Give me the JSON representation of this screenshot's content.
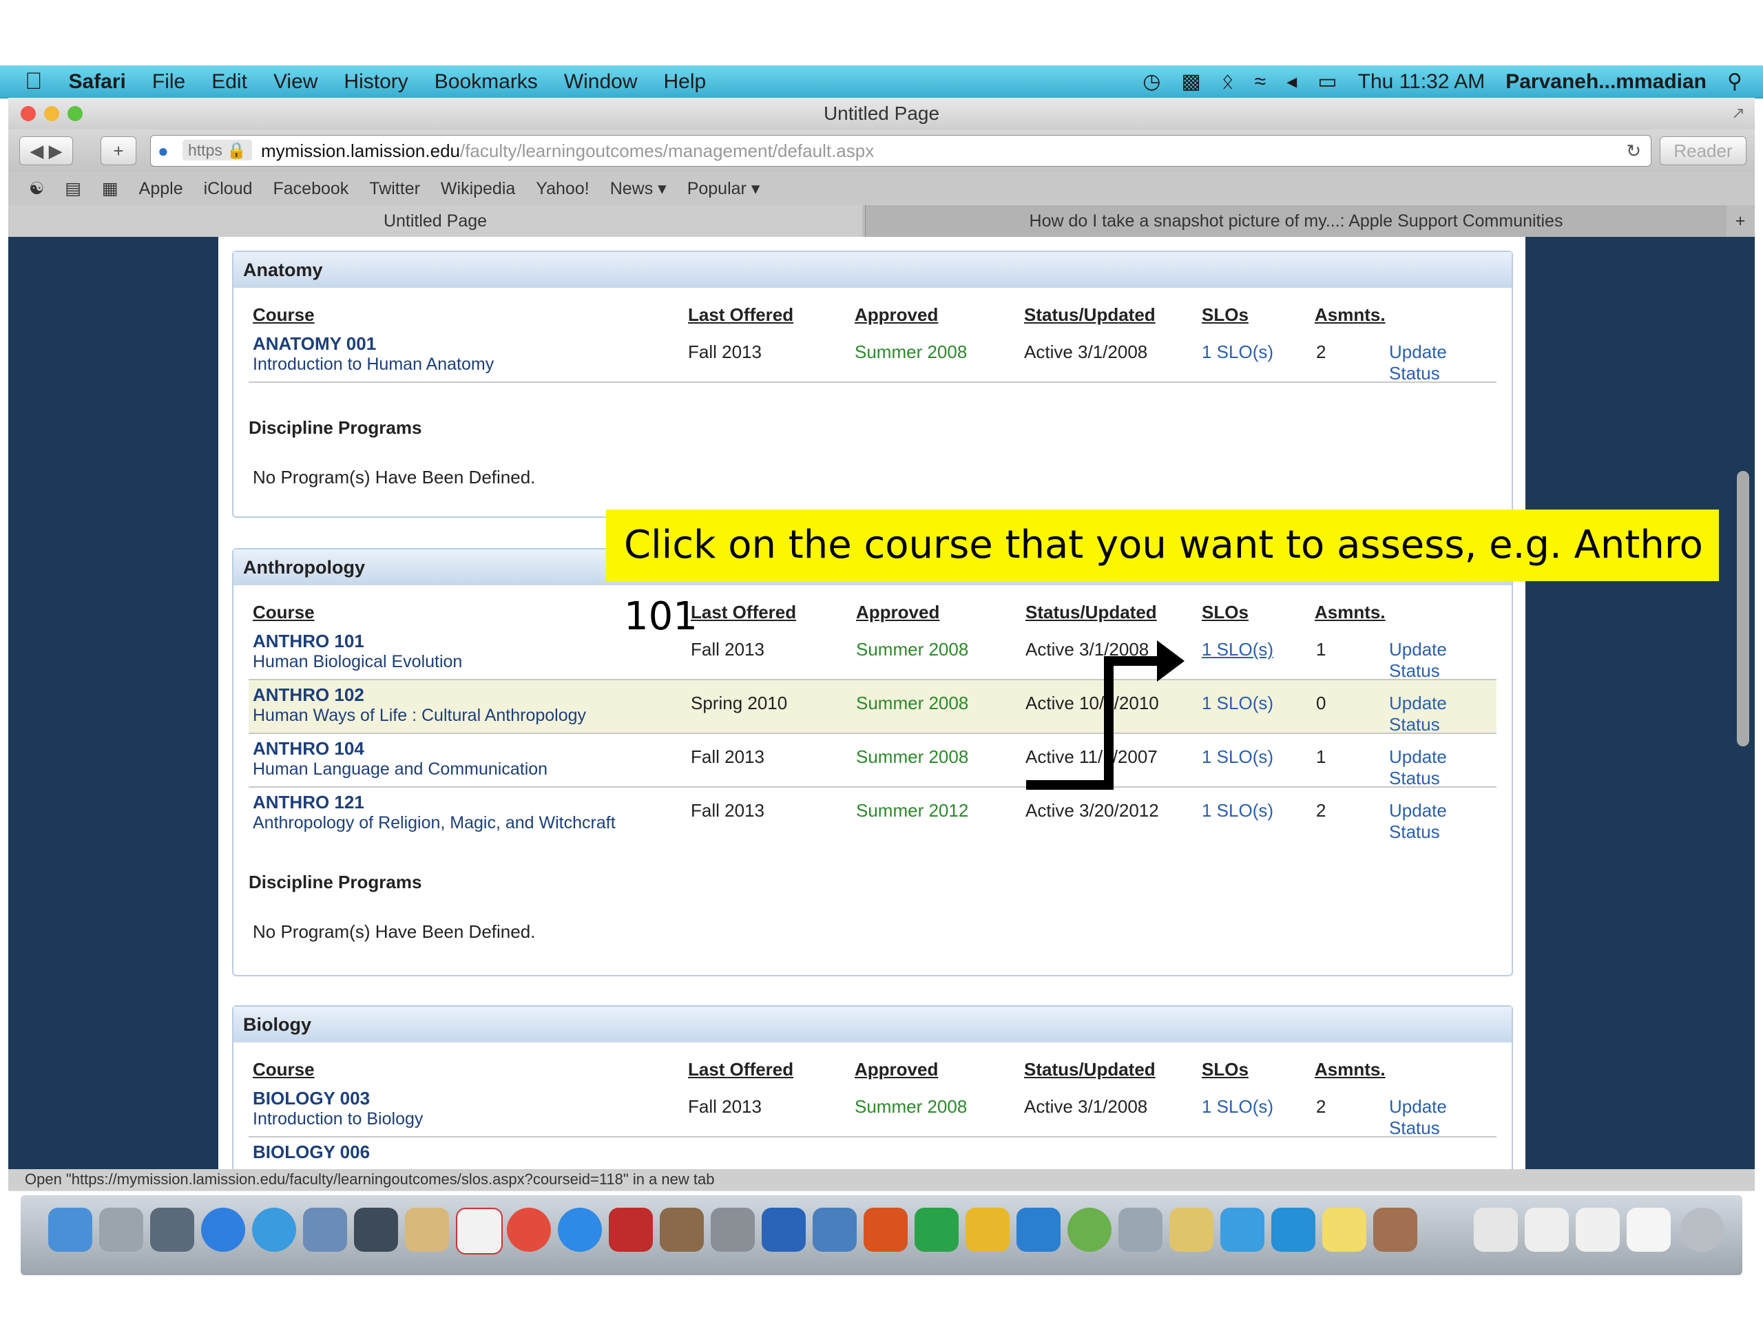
{
  "menubar": {
    "app": "Safari",
    "items": [
      "File",
      "Edit",
      "View",
      "History",
      "Bookmarks",
      "Window",
      "Help"
    ],
    "clock": "Thu 11:32 AM",
    "user": "Parvaneh...mmadian"
  },
  "window": {
    "title": "Untitled Page",
    "url_scheme": "https",
    "url_host": "mymission.lamission.edu",
    "url_path": "/faculty/learningoutcomes/management/default.aspx",
    "reader": "Reader"
  },
  "bookmarks": [
    "Apple",
    "iCloud",
    "Facebook",
    "Twitter",
    "Wikipedia",
    "Yahoo!",
    "News ▾",
    "Popular ▾"
  ],
  "tabs": [
    "Untitled Page",
    "How do I take a snapshot picture of my...: Apple Support Communities"
  ],
  "columns": {
    "course": "Course",
    "last_offered": "Last Offered",
    "approved": "Approved",
    "status": "Status/Updated",
    "slos": "SLOs",
    "asmnts": "Asmnts."
  },
  "sections": [
    {
      "name": "Anatomy",
      "courses": [
        {
          "code": "ANATOMY 001",
          "title": "Introduction to Human Anatomy",
          "last_offered": "Fall 2013",
          "approved": "Summer 2008",
          "status": "Active 3/1/2008",
          "slos": "1 SLO(s)",
          "asmnts": "2",
          "action": "Update Status"
        }
      ],
      "programs_label": "Discipline Programs",
      "programs_text": "No Program(s) Have Been Defined."
    },
    {
      "name": "Anthropology",
      "courses": [
        {
          "code": "ANTHRO 101",
          "title": "Human Biological Evolution",
          "last_offered": "Fall 2013",
          "approved": "Summer 2008",
          "status": "Active 3/1/2008",
          "slos": "1 SLO(s)",
          "asmnts": "1",
          "action": "Update Status"
        },
        {
          "code": "ANTHRO 102",
          "title": "Human Ways of Life : Cultural Anthropology",
          "last_offered": "Spring 2010",
          "approved": "Summer 2008",
          "status": "Active 10/5/2010",
          "slos": "1 SLO(s)",
          "asmnts": "0",
          "action": "Update Status"
        },
        {
          "code": "ANTHRO 104",
          "title": "Human Language and Communication",
          "last_offered": "Fall 2013",
          "approved": "Summer 2008",
          "status": "Active 11/1/2007",
          "slos": "1 SLO(s)",
          "asmnts": "1",
          "action": "Update Status"
        },
        {
          "code": "ANTHRO 121",
          "title": "Anthropology of Religion, Magic, and Witchcraft",
          "last_offered": "Fall 2013",
          "approved": "Summer 2012",
          "status": "Active 3/20/2012",
          "slos": "1 SLO(s)",
          "asmnts": "2",
          "action": "Update Status"
        }
      ],
      "programs_label": "Discipline Programs",
      "programs_text": "No Program(s) Have Been Defined."
    },
    {
      "name": "Biology",
      "courses": [
        {
          "code": "BIOLOGY 003",
          "title": "Introduction to Biology",
          "last_offered": "Fall 2013",
          "approved": "Summer 2008",
          "status": "Active 3/1/2008",
          "slos": "1 SLO(s)",
          "asmnts": "2",
          "action": "Update Status"
        },
        {
          "code": "BIOLOGY 006",
          "title": "",
          "last_offered": "",
          "approved": "",
          "status": "",
          "slos": "",
          "asmnts": "",
          "action": ""
        }
      ]
    }
  ],
  "callout": "Click on the course that you want to assess, e.g. Anthro 101",
  "statusbar": "Open \"https://mymission.lamission.edu/faculty/learningoutcomes/slos.aspx?courseid=118\" in a new tab"
}
